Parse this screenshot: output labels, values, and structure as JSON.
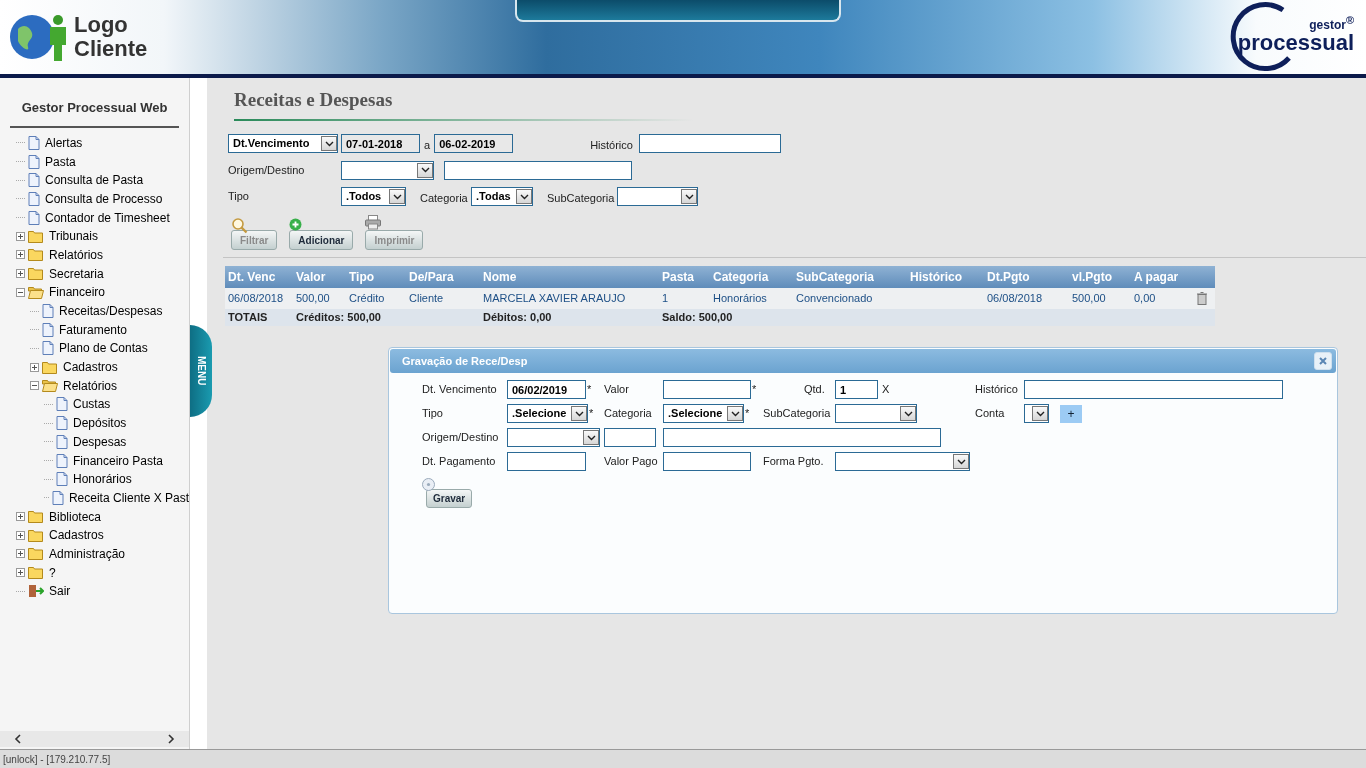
{
  "header": {
    "logo_lines": [
      "Logo",
      "Cliente"
    ],
    "brand_small": "gestor",
    "brand_mark": "®",
    "brand_name": "processual"
  },
  "sidebar": {
    "title": "Gestor Processual Web",
    "items": [
      {
        "kind": "page",
        "label": "Alertas"
      },
      {
        "kind": "page",
        "label": "Pasta"
      },
      {
        "kind": "page",
        "label": "Consulta de Pasta"
      },
      {
        "kind": "page",
        "label": "Consulta de Processo"
      },
      {
        "kind": "page",
        "label": "Contador de Timesheet"
      },
      {
        "kind": "folder",
        "label": "Tribunais",
        "expanded": false
      },
      {
        "kind": "folder",
        "label": "Relatórios",
        "expanded": false
      },
      {
        "kind": "folder",
        "label": "Secretaria",
        "expanded": false
      },
      {
        "kind": "folder",
        "label": "Financeiro",
        "expanded": true,
        "children": [
          {
            "kind": "page",
            "label": "Receitas/Despesas"
          },
          {
            "kind": "page",
            "label": "Faturamento"
          },
          {
            "kind": "page",
            "label": "Plano de Contas"
          },
          {
            "kind": "folder",
            "label": "Cadastros",
            "expanded": false
          },
          {
            "kind": "folder",
            "label": "Relatórios",
            "expanded": true,
            "children": [
              {
                "kind": "page",
                "label": "Custas"
              },
              {
                "kind": "page",
                "label": "Depósitos"
              },
              {
                "kind": "page",
                "label": "Despesas"
              },
              {
                "kind": "page",
                "label": "Financeiro Pasta"
              },
              {
                "kind": "page",
                "label": "Honorários"
              },
              {
                "kind": "page",
                "label": "Receita Cliente X Past"
              }
            ]
          }
        ]
      },
      {
        "kind": "folder",
        "label": "Biblioteca",
        "expanded": false
      },
      {
        "kind": "folder",
        "label": "Cadastros",
        "expanded": false
      },
      {
        "kind": "folder",
        "label": "Administração",
        "expanded": false
      },
      {
        "kind": "folder",
        "label": "?",
        "expanded": false
      },
      {
        "kind": "exit",
        "label": "Sair"
      }
    ]
  },
  "menu_tab": "MENU",
  "page_title": "Receitas e Despesas",
  "filters": {
    "date_field": "Dt.Vencimento",
    "date_from": "07-01-2018",
    "between": "a",
    "date_to": "06-02-2019",
    "historico_label": "Histórico",
    "origem_label": "Origem/Destino",
    "tipo_label": "Tipo",
    "tipo_value": ".Todos",
    "categoria_label": "Categoria",
    "categoria_value": ".Todas",
    "subcategoria_label": "SubCategoria"
  },
  "toolbar": [
    {
      "kind": "search",
      "label": "Filtrar",
      "disabled": true
    },
    {
      "kind": "add",
      "label": "Adicionar",
      "disabled": false
    },
    {
      "kind": "print",
      "label": "Imprimir",
      "disabled": true
    }
  ],
  "table": {
    "columns": [
      "Dt. Venc",
      "Valor",
      "Tipo",
      "De/Para",
      "Nome",
      "Pasta",
      "Categoria",
      "SubCategoria",
      "Histórico",
      "Dt.Pgto",
      "vl.Pgto",
      "A pagar"
    ],
    "rows": [
      [
        "06/08/2018",
        "500,00",
        "Crédito",
        "Cliente",
        "MARCELA XAVIER ARAUJO",
        "1",
        "Honorários",
        "Convencionado",
        "",
        "06/08/2018",
        "500,00",
        "0,00"
      ]
    ],
    "totals": {
      "label": "TOTAIS",
      "credits": "Créditos: 500,00",
      "debits": "Débitos: 0,00",
      "balance": "Saldo: 500,00"
    }
  },
  "dialog": {
    "title": "Gravação de Rece/Desp",
    "required": "*",
    "dt_venc_label": "Dt. Vencimento",
    "dt_venc_value": "06/02/2019",
    "valor_label": "Valor",
    "qtd_label": "Qtd.",
    "qtd_value": "1",
    "qtd_suffix": "X",
    "historico_label": "Histórico",
    "tipo_label": "Tipo",
    "tipo_value": ".Selecione",
    "categoria_label": "Categoria",
    "categoria_value": ".Selecione",
    "subcategoria_label": "SubCategoria",
    "conta_label": "Conta",
    "add_label": "+",
    "origem_label": "Origem/Destino",
    "dt_pag_label": "Dt. Pagamento",
    "valor_pago_label": "Valor Pago",
    "forma_label": "Forma Pgto.",
    "save_label": "Gravar"
  },
  "status_bar": "[unlock] - [179.210.77.5]"
}
